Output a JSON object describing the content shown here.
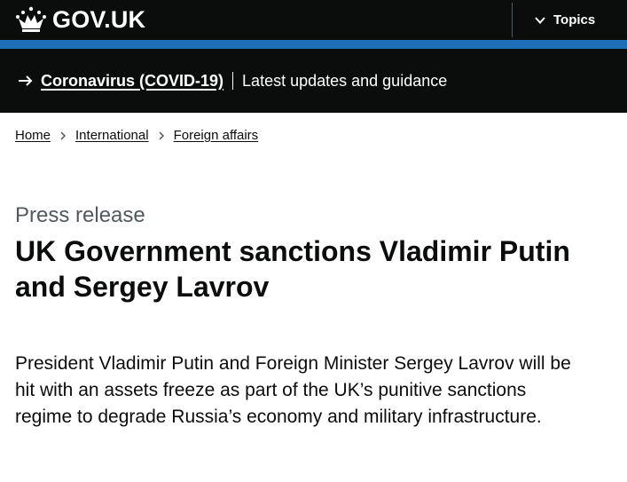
{
  "header": {
    "logo_text": "GOV.UK",
    "topics_label": "Topics",
    "logo_icon": "crown-icon",
    "topics_icon": "chevron-down-icon"
  },
  "covid_banner": {
    "link_text": "Coronavirus (COVID-19)",
    "description": "Latest updates and guidance",
    "icon": "arrow-right-icon"
  },
  "breadcrumb": {
    "items": [
      "Home",
      "International",
      "Foreign affairs"
    ]
  },
  "article": {
    "document_type": "Press release",
    "title": "UK Government sanctions Vladimir Putin and Sergey Lavrov",
    "lede": "President Vladimir Putin and Foreign Minister Sergey Lavrov will be hit with an assets freeze as part of the UK’s punitive sanctions regime to degrade Russia’s economy and military infrastructure."
  },
  "colors": {
    "header_bg": "#0b0c0c",
    "accent_blue": "#1d70b8",
    "text": "#0b0c0c",
    "secondary_text": "#505a5f"
  }
}
